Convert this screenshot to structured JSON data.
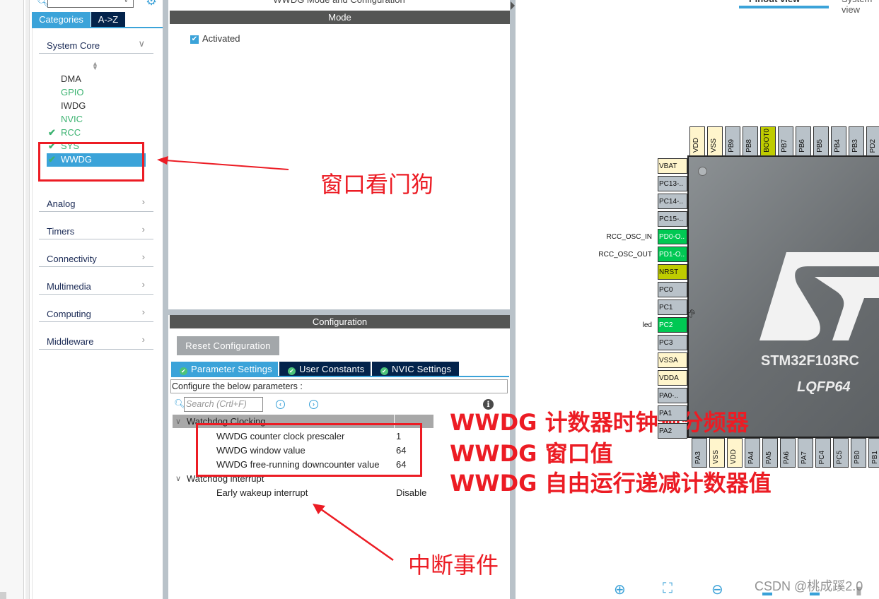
{
  "sidebar": {
    "tabs": {
      "categories": "Categories",
      "az": "A->Z"
    },
    "categories": [
      {
        "label": "System Core",
        "expanded": true
      },
      {
        "label": "Analog",
        "expanded": false
      },
      {
        "label": "Timers",
        "expanded": false
      },
      {
        "label": "Connectivity",
        "expanded": false
      },
      {
        "label": "Multimedia",
        "expanded": false
      },
      {
        "label": "Computing",
        "expanded": false
      },
      {
        "label": "Middleware",
        "expanded": false
      }
    ],
    "system_core_items": [
      {
        "label": "DMA",
        "checked": false,
        "color": "#333333"
      },
      {
        "label": "GPIO",
        "checked": false,
        "color": "#3cb371"
      },
      {
        "label": "IWDG",
        "checked": false,
        "color": "#333333"
      },
      {
        "label": "NVIC",
        "checked": false,
        "color": "#3cb371"
      },
      {
        "label": "RCC",
        "checked": true,
        "color": "#3cb371"
      },
      {
        "label": "SYS",
        "checked": true,
        "color": "#3cb371"
      },
      {
        "label": "WWDG",
        "checked": true,
        "selected": true,
        "color": "#ffffff"
      }
    ]
  },
  "mode_panel": {
    "window_title": "WWDG Mode and Configuration",
    "header": "Mode",
    "activated_label": "Activated",
    "activated": true
  },
  "config_panel": {
    "header": "Configuration",
    "reset_button": "Reset Configuration",
    "tabs": [
      "Parameter Settings",
      "User Constants",
      "NVIC Settings"
    ],
    "active_tab": "Parameter Settings",
    "configure_label": "Configure the below parameters :",
    "search_placeholder": "Search (Crtl+F)",
    "groups": [
      {
        "name": "Watchdog Clocking",
        "params": [
          {
            "name": "WWDG counter clock prescaler",
            "value": "1"
          },
          {
            "name": "WWDG window value",
            "value": "64"
          },
          {
            "name": "WWDG free-running downcounter value",
            "value": "64"
          }
        ]
      },
      {
        "name": "Watchdog interrupt",
        "params": [
          {
            "name": "Early wakeup interrupt",
            "value": "Disable"
          }
        ]
      }
    ]
  },
  "pinout": {
    "tabs": {
      "pinout_view": "Pinout view",
      "system_view": "System view"
    },
    "chip_name": "STM32F103RC",
    "package": "LQFP64",
    "top_pins": [
      {
        "name": "VDD",
        "state": "power"
      },
      {
        "name": "VSS",
        "state": "power"
      },
      {
        "name": "PB9",
        "state": "free"
      },
      {
        "name": "PB8",
        "state": "free"
      },
      {
        "name": "BOOT0",
        "state": "fixed"
      },
      {
        "name": "PB7",
        "state": "free"
      },
      {
        "name": "PB6",
        "state": "free"
      },
      {
        "name": "PB5",
        "state": "free"
      },
      {
        "name": "PB4",
        "state": "free"
      },
      {
        "name": "PB3",
        "state": "free"
      },
      {
        "name": "PD2",
        "state": "free"
      }
    ],
    "left_pins": [
      {
        "name": "VBAT",
        "state": "power",
        "label": ""
      },
      {
        "name": "PC13-..",
        "state": "free",
        "label": ""
      },
      {
        "name": "PC14-..",
        "state": "free",
        "label": ""
      },
      {
        "name": "PC15-..",
        "state": "free",
        "label": ""
      },
      {
        "name": "PD0-O..",
        "state": "used",
        "label": "RCC_OSC_IN"
      },
      {
        "name": "PD1-O..",
        "state": "used",
        "label": "RCC_OSC_OUT"
      },
      {
        "name": "NRST",
        "state": "fixed",
        "label": ""
      },
      {
        "name": "PC0",
        "state": "free",
        "label": ""
      },
      {
        "name": "PC1",
        "state": "free",
        "label": ""
      },
      {
        "name": "PC2",
        "state": "used",
        "label": "led"
      },
      {
        "name": "PC3",
        "state": "free",
        "label": ""
      },
      {
        "name": "VSSA",
        "state": "power",
        "label": ""
      },
      {
        "name": "VDDA",
        "state": "power",
        "label": ""
      },
      {
        "name": "PA0-..",
        "state": "free",
        "label": ""
      },
      {
        "name": "PA1",
        "state": "free",
        "label": ""
      },
      {
        "name": "PA2",
        "state": "free",
        "label": ""
      }
    ],
    "bottom_pins": [
      {
        "name": "PA3",
        "state": "free"
      },
      {
        "name": "VSS",
        "state": "power"
      },
      {
        "name": "VDD",
        "state": "power"
      },
      {
        "name": "PA4",
        "state": "free"
      },
      {
        "name": "PA5",
        "state": "free"
      },
      {
        "name": "PA6",
        "state": "free"
      },
      {
        "name": "PA7",
        "state": "free"
      },
      {
        "name": "PC4",
        "state": "free"
      },
      {
        "name": "PC5",
        "state": "free"
      },
      {
        "name": "PB0",
        "state": "free"
      },
      {
        "name": "PB1",
        "state": "free"
      }
    ],
    "pin_colors": {
      "free": "#b9c2c9",
      "power": "#fff5cc",
      "used": "#00c853",
      "fixed": "#bfcc00"
    },
    "toolbar_icons": [
      "zoom-in-icon",
      "fit-screen-icon",
      "zoom-out-icon",
      "export-icon",
      "export-icon-2",
      "split-icon"
    ]
  },
  "annotations": {
    "wwdg_label": "窗口看门狗",
    "param_labels": [
      "WWDG 计数器时钟预分频器",
      "WWDG 窗口值",
      "WWDG 自由运行递减计数器值"
    ],
    "interrupt_label": "中断事件",
    "color": "#ec1c24"
  },
  "watermark": "CSDN @桃成蹊2.0"
}
